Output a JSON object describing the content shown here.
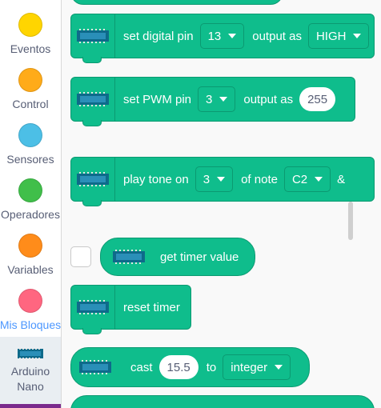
{
  "sidebar": {
    "categories": [
      {
        "label": "Eventos",
        "color": "#ffd500"
      },
      {
        "label": "Control",
        "color": "#ffab19"
      },
      {
        "label": "Sensores",
        "color": "#4cbfe6"
      },
      {
        "label": "Operadores",
        "color": "#40bf4a"
      },
      {
        "label": "Variables",
        "color": "#ff8c1a"
      },
      {
        "label": "Mis Bloques",
        "color": "#ff6680"
      }
    ],
    "extension": {
      "label_line1": "Arduino",
      "label_line2": "Nano",
      "icon": "arduino-nano-board-icon"
    }
  },
  "palette": {
    "block_color": "#0fbd8c",
    "set_digital": {
      "label": "set digital pin",
      "pin": "13",
      "mid": "output as",
      "value": "HIGH"
    },
    "set_pwm": {
      "label": "set PWM pin",
      "pin": "3",
      "mid": "output as",
      "value": "255"
    },
    "play_tone": {
      "label": "play tone on",
      "pin": "3",
      "mid": "of note",
      "note": "C2",
      "tail": "&"
    },
    "timer_value": {
      "label": "get timer value"
    },
    "reset_timer": {
      "label": "reset timer"
    },
    "cast": {
      "label": "cast",
      "value": "15.5",
      "mid": "to",
      "type": "integer"
    }
  }
}
